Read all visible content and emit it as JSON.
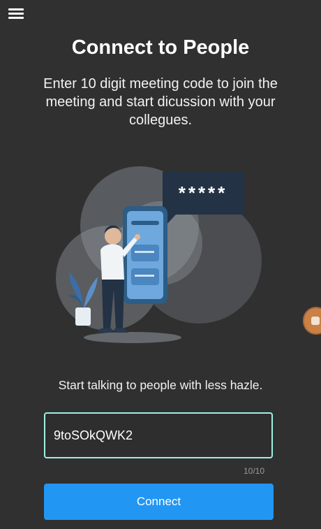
{
  "header": {
    "menu_icon": "hamburger-menu-icon",
    "title": "Connect to People",
    "description": "Enter 10 digit meeting code to join the meeting and start dicussion with your collegues."
  },
  "illustration": {
    "password_bubble": "*****"
  },
  "form": {
    "tagline": "Start talking to people with less hazle.",
    "code_value": "9toSOkQWK2",
    "char_counter": "10/10",
    "connect_label": "Connect"
  },
  "floating": {
    "icon": "floating-bubble-icon"
  },
  "colors": {
    "background": "#303030",
    "accent": "#2196f3",
    "input_border": "#9ff0e3",
    "counter_text": "#9a9a9a"
  }
}
